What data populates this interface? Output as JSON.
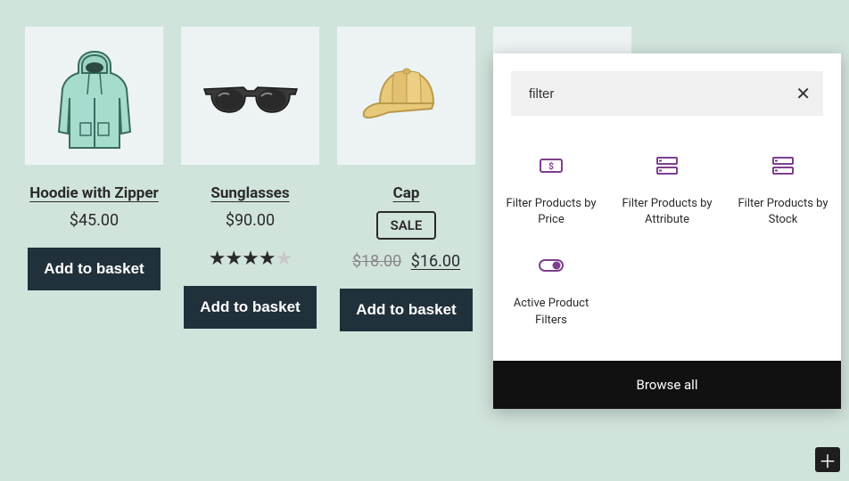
{
  "products": [
    {
      "title": "Hoodie with Zipper",
      "price": "$45.00",
      "add_label": "Add to basket"
    },
    {
      "title": "Sunglasses",
      "price": "$90.00",
      "add_label": "Add to basket",
      "rating": 4
    },
    {
      "title": "Cap",
      "sale_label": "SALE",
      "old_price": "$18.00",
      "new_price": "$16.00",
      "add_label": "Add to basket"
    }
  ],
  "inserter": {
    "search_value": "filter",
    "items": [
      {
        "label": "Filter Products by Price"
      },
      {
        "label": "Filter Products by Attribute"
      },
      {
        "label": "Filter Products by Stock"
      },
      {
        "label": "Active Product Filters"
      }
    ],
    "browse_all_label": "Browse all"
  }
}
